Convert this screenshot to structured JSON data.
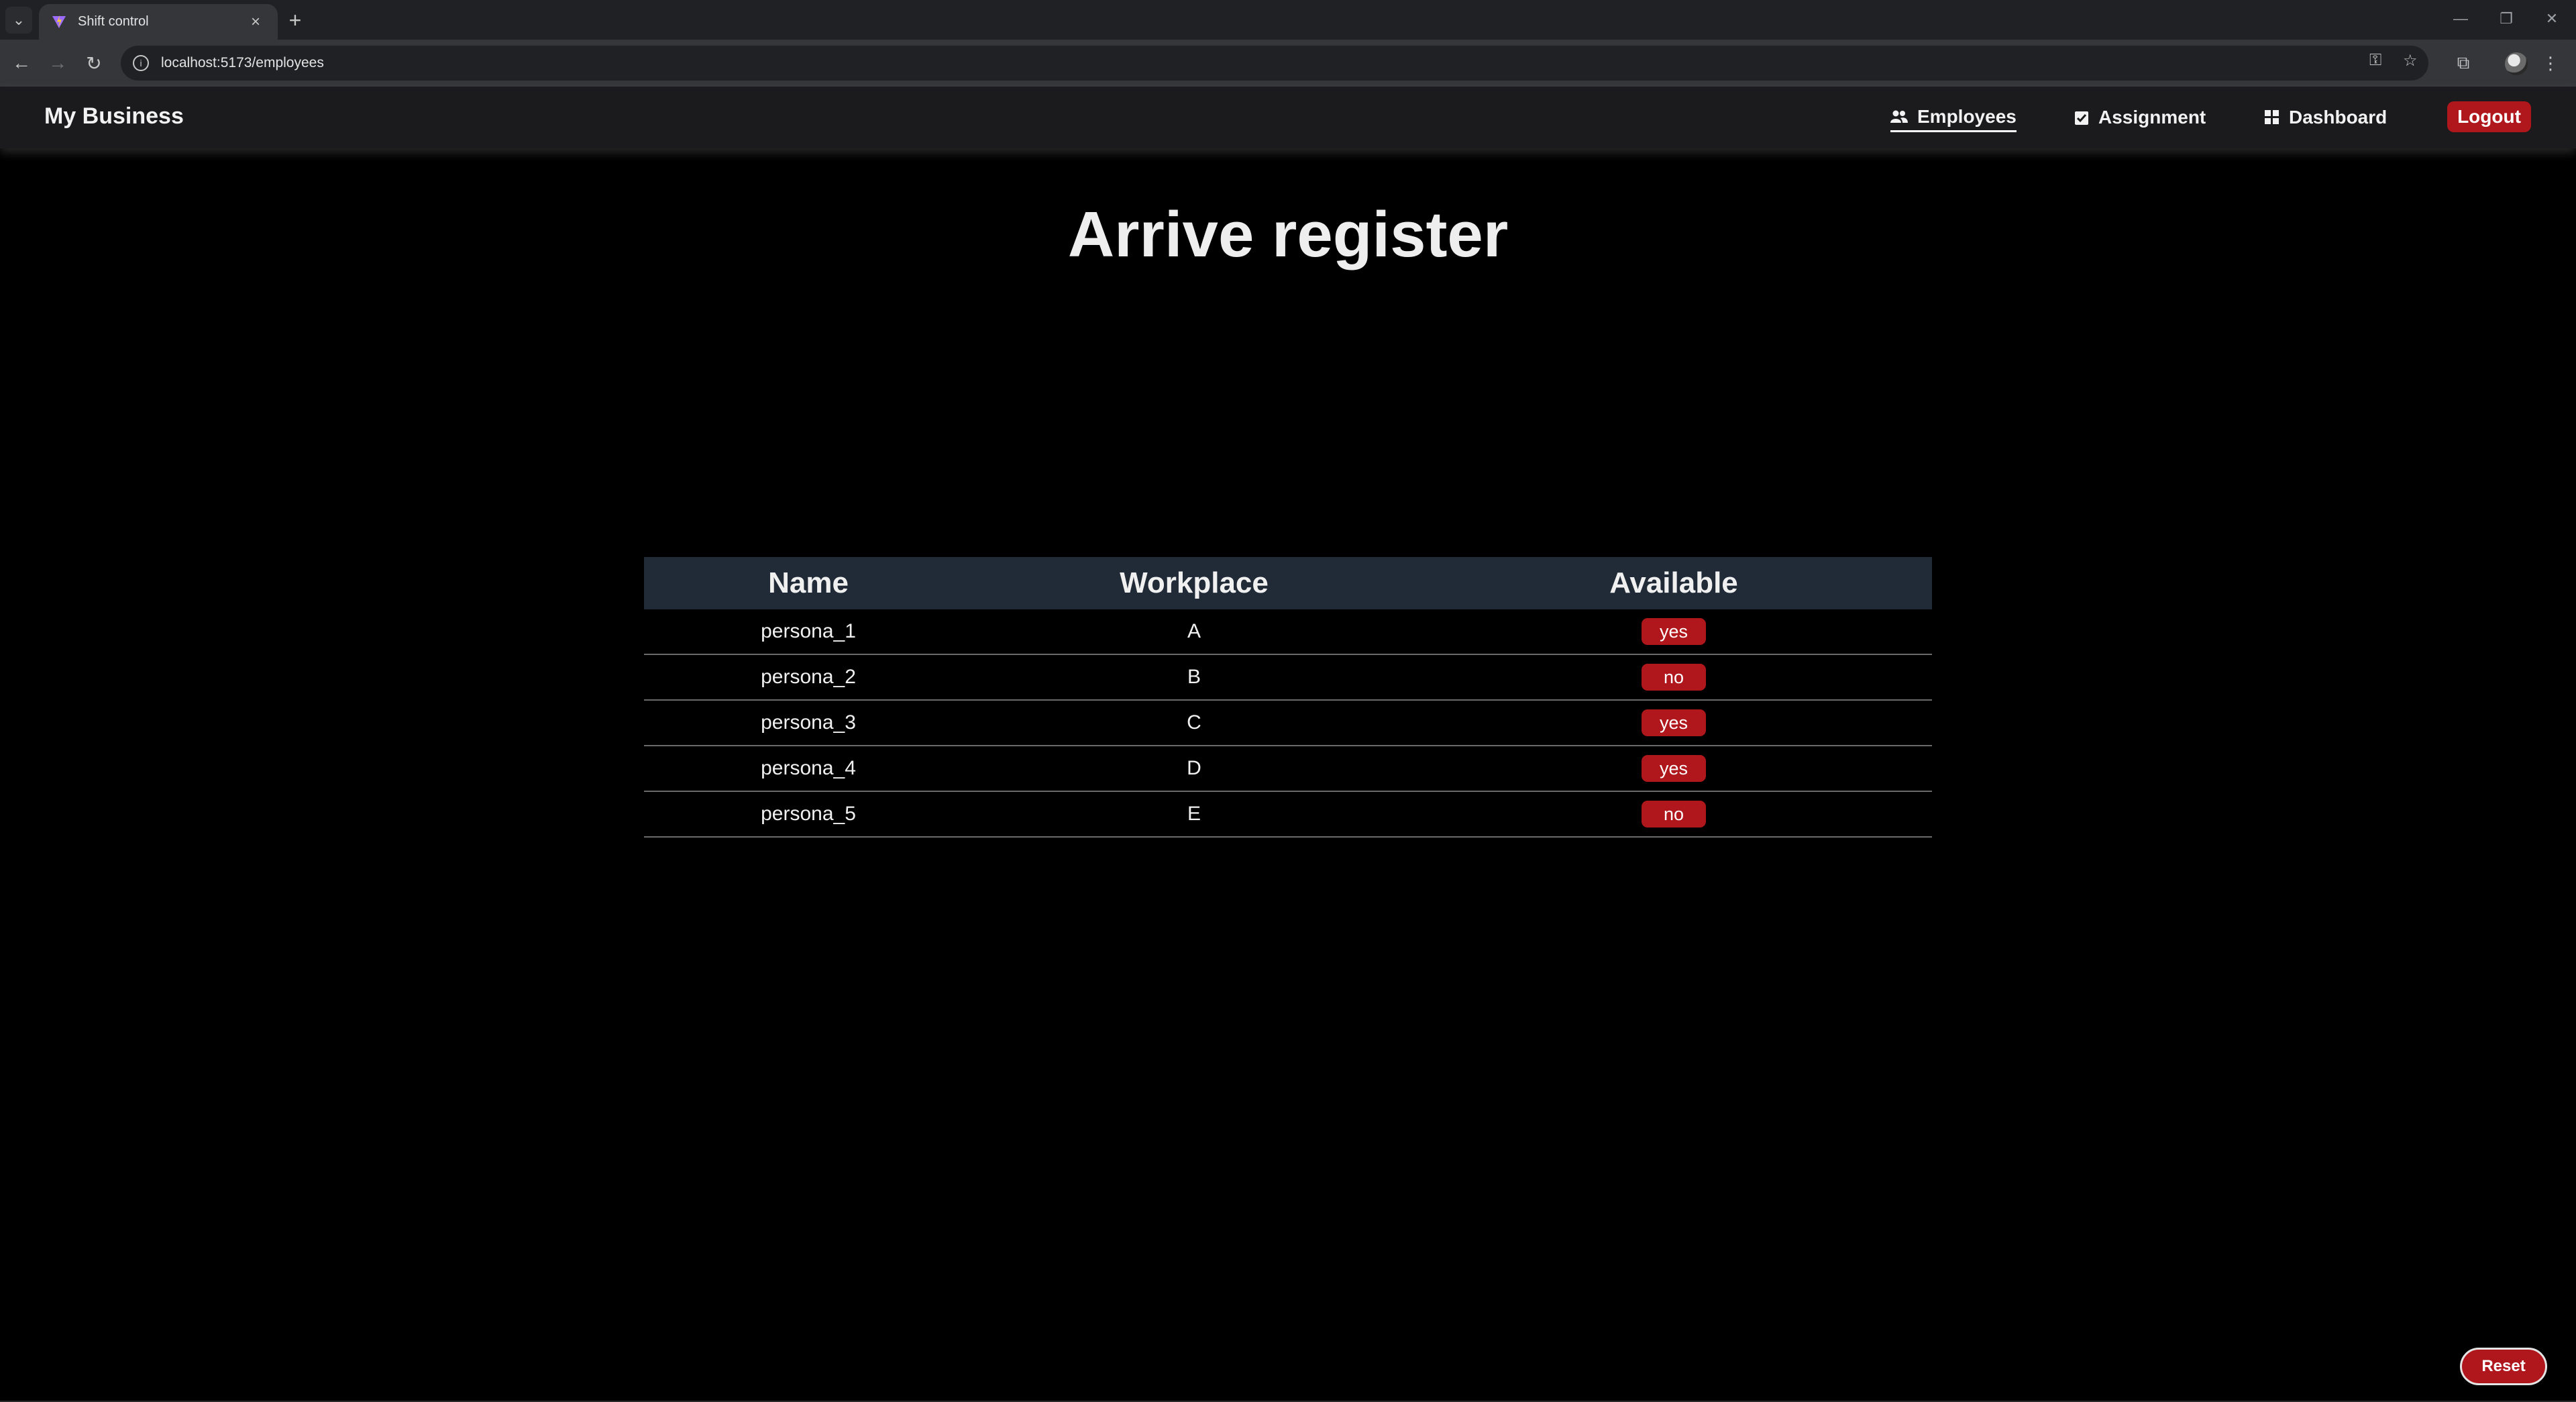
{
  "browser": {
    "tab_title": "Shift control",
    "url": "localhost:5173/employees"
  },
  "navbar": {
    "brand": "My Business",
    "links": [
      {
        "label": "Employees",
        "icon": "users-icon",
        "active": true
      },
      {
        "label": "Assignment",
        "icon": "clipboard-check-icon",
        "active": false
      },
      {
        "label": "Dashboard",
        "icon": "grid-icon",
        "active": false
      }
    ],
    "logout_label": "Logout"
  },
  "page": {
    "title": "Arrive register"
  },
  "table": {
    "headers": [
      "Name",
      "Workplace",
      "Available"
    ],
    "rows": [
      {
        "name": "persona_1",
        "workplace": "A",
        "available": "yes"
      },
      {
        "name": "persona_2",
        "workplace": "B",
        "available": "no"
      },
      {
        "name": "persona_3",
        "workplace": "C",
        "available": "yes"
      },
      {
        "name": "persona_4",
        "workplace": "D",
        "available": "yes"
      },
      {
        "name": "persona_5",
        "workplace": "E",
        "available": "no"
      }
    ]
  },
  "reset_label": "Reset",
  "colors": {
    "accent": "#b0171c",
    "table_header_bg": "#212a37",
    "navbar_bg": "#1b1b1d",
    "page_bg": "#000000"
  }
}
